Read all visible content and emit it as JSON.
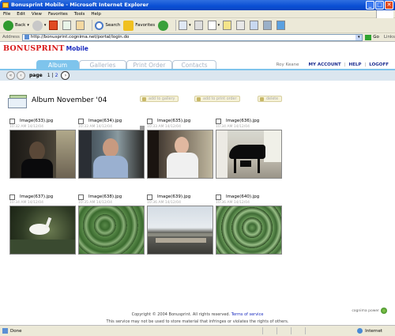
{
  "window": {
    "title": "Bonusprint Mobile - Microsoft Internet Explorer",
    "controls": [
      "_",
      "□",
      "✕"
    ]
  },
  "menu": [
    "File",
    "Edit",
    "View",
    "Favorites",
    "Tools",
    "Help"
  ],
  "toolbar": {
    "back_label": "Back",
    "search_label": "Search",
    "favorites_label": "Favorites"
  },
  "address": {
    "label": "Address",
    "url": "http://bonusprint.cognima.net/portal/login.do",
    "go_label": "Go",
    "links_label": "Links"
  },
  "site": {
    "brand_main": "BONUSPRINT",
    "brand_sub": "Mobile",
    "colors": {
      "brand_red": "#d81818",
      "brand_blue": "#1a2bbf",
      "tab_active": "#7ec4ec"
    }
  },
  "tabs": [
    {
      "label": "Album",
      "active": true
    },
    {
      "label": "Galleries",
      "active": false
    },
    {
      "label": "Print Order",
      "active": false
    },
    {
      "label": "Contacts",
      "active": false
    }
  ],
  "user": {
    "name": "Roy Keane",
    "my_account": "MY ACCOUNT",
    "help": "HELP",
    "logoff": "LOGOFF",
    "separator": "|"
  },
  "pager": {
    "label": "page",
    "current": "1",
    "separator": "|",
    "next_page": "2"
  },
  "album": {
    "title": "Album November '04",
    "actions": {
      "add_to_gallery": "add to gallery",
      "add_to_print_order": "add to print order",
      "delete": "delete"
    }
  },
  "images": [
    {
      "name": "Image(633).jpg",
      "date": "10:32 AM 14/12/04",
      "scene": "dark-room-man"
    },
    {
      "name": "Image(634).jpg",
      "date": "10:33 AM 14/12/04",
      "scene": "man-in-office"
    },
    {
      "name": "Image(635).jpg",
      "date": "10:33 AM 14/12/04",
      "scene": "man-white-shirt"
    },
    {
      "name": "Image(636).jpg",
      "date": "10:34 AM 14/12/04",
      "scene": "grand-piano"
    },
    {
      "name": "Image(637).jpg",
      "date": "10:34 AM 14/12/04",
      "scene": "white-bird"
    },
    {
      "name": "Image(638).jpg",
      "date": "10:35 AM 14/12/04",
      "scene": "green-leaves"
    },
    {
      "name": "Image(639).jpg",
      "date": "10:36 AM 14/12/04",
      "scene": "rooftop-sky"
    },
    {
      "name": "Image(640).jpg",
      "date": "10:36 AM 14/12/04",
      "scene": "green-plants"
    }
  ],
  "footer": {
    "copyright": "Copyright © 2004 Bonusprint. All rights reserved.",
    "terms": "Terms of service",
    "notice": "This service may not be used to store material that infringes or violates the rights of others.",
    "powered_by": "cognima power"
  },
  "status": {
    "text": "Done",
    "zone": "Internet"
  }
}
